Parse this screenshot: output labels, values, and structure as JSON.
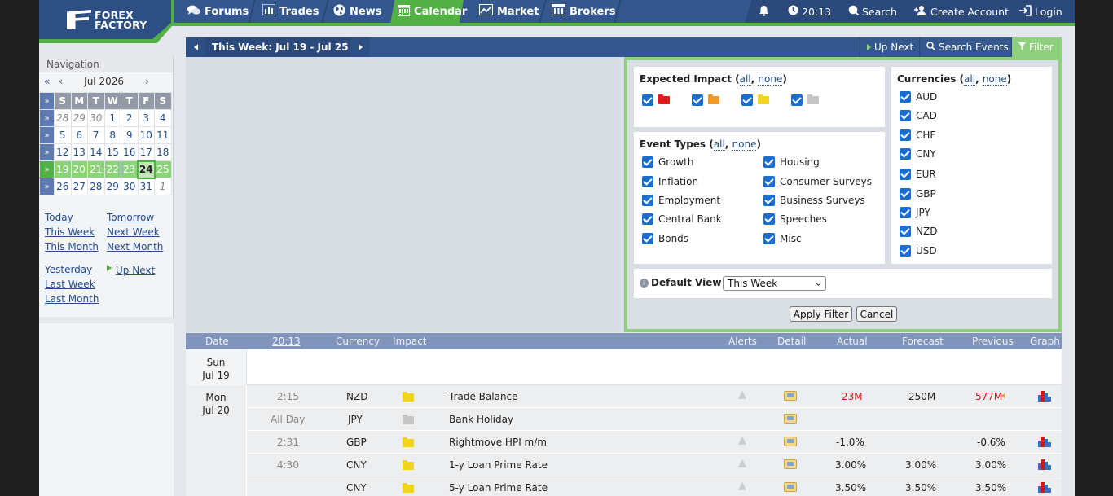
{
  "header": {
    "logo_line1": "FOREX",
    "logo_line2": "FACTORY",
    "nav": [
      {
        "label": "Forums",
        "icon": "chat-bubbles-icon"
      },
      {
        "label": "Trades",
        "icon": "bar-chart-icon"
      },
      {
        "label": "News",
        "icon": "globe-icon"
      },
      {
        "label": "Calendar",
        "icon": "calendar-icon",
        "active": true
      },
      {
        "label": "Market",
        "icon": "line-chart-icon"
      },
      {
        "label": "Brokers",
        "icon": "building-icon"
      }
    ],
    "time": "20:13",
    "search_label": "Search",
    "create_account_label": "Create Account",
    "login_label": "Login"
  },
  "sidebar": {
    "title": "Navigation",
    "month_label": "Jul 2026",
    "prev_year": "«",
    "prev_month": "‹",
    "next_month": "›",
    "weekdays": [
      "S",
      "M",
      "T",
      "W",
      "T",
      "F",
      "S"
    ],
    "weeks": [
      [
        "28",
        "29",
        "30",
        "1",
        "2",
        "3",
        "4"
      ],
      [
        "5",
        "6",
        "7",
        "8",
        "9",
        "10",
        "11"
      ],
      [
        "12",
        "13",
        "14",
        "15",
        "16",
        "17",
        "18"
      ],
      [
        "19",
        "20",
        "21",
        "22",
        "23",
        "24",
        "25"
      ],
      [
        "26",
        "27",
        "28",
        "29",
        "30",
        "31",
        "1"
      ]
    ],
    "links": {
      "today": "Today",
      "tomorrow": "Tomorrow",
      "this_week": "This Week",
      "next_week": "Next Week",
      "this_month": "This Month",
      "next_month": "Next Month",
      "yesterday": "Yesterday",
      "up_next": "Up Next",
      "last_week": "Last Week",
      "last_month": "Last Month"
    }
  },
  "weekbar": {
    "label": "This Week: Jul 19 - Jul 25",
    "up_next": "Up Next",
    "search_events": "Search Events",
    "filter": "Filter"
  },
  "filter": {
    "impact_title": "Expected Impact",
    "all": "all",
    "none": "none",
    "event_types_title": "Event Types",
    "event_types": [
      "Growth",
      "Inflation",
      "Employment",
      "Central Bank",
      "Bonds",
      "Housing",
      "Consumer Surveys",
      "Business Surveys",
      "Speeches",
      "Misc"
    ],
    "currencies_title": "Currencies",
    "currencies": [
      "AUD",
      "CAD",
      "CHF",
      "CNY",
      "EUR",
      "GBP",
      "JPY",
      "NZD",
      "USD"
    ],
    "default_view_label": "Default View",
    "default_view_value": "This Week",
    "apply_label": "Apply Filter",
    "cancel_label": "Cancel"
  },
  "table": {
    "headers": {
      "date": "Date",
      "time": "20:13",
      "currency": "Currency",
      "impact": "Impact",
      "alerts": "Alerts",
      "detail": "Detail",
      "actual": "Actual",
      "forecast": "Forecast",
      "previous": "Previous",
      "graph": "Graph"
    },
    "day1": {
      "weekday": "Sun",
      "date": "Jul 19"
    },
    "day2": {
      "weekday": "Mon",
      "date": "Jul 20"
    },
    "rows": [
      {
        "time": "2:15",
        "currency": "NZD",
        "impact": "yellow",
        "event": "Trade Balance",
        "actual": "23M",
        "forecast": "250M",
        "previous": "577M"
      },
      {
        "time": "All Day",
        "currency": "JPY",
        "impact": "gray",
        "event": "Bank Holiday",
        "actual": "",
        "forecast": "",
        "previous": ""
      },
      {
        "time": "2:31",
        "currency": "GBP",
        "impact": "yellow",
        "event": "Rightmove HPI m/m",
        "actual": "-1.0%",
        "forecast": "",
        "previous": "-0.6%"
      },
      {
        "time": "4:30",
        "currency": "CNY",
        "impact": "yellow",
        "event": "1-y Loan Prime Rate",
        "actual": "3.00%",
        "forecast": "3.00%",
        "previous": "3.00%"
      },
      {
        "time": "",
        "currency": "CNY",
        "impact": "yellow",
        "event": "5-y Loan Prime Rate",
        "actual": "3.50%",
        "forecast": "3.50%",
        "previous": "3.50%"
      }
    ],
    "colors": {
      "worse": "#d4151b",
      "neutral": "#222222"
    }
  }
}
